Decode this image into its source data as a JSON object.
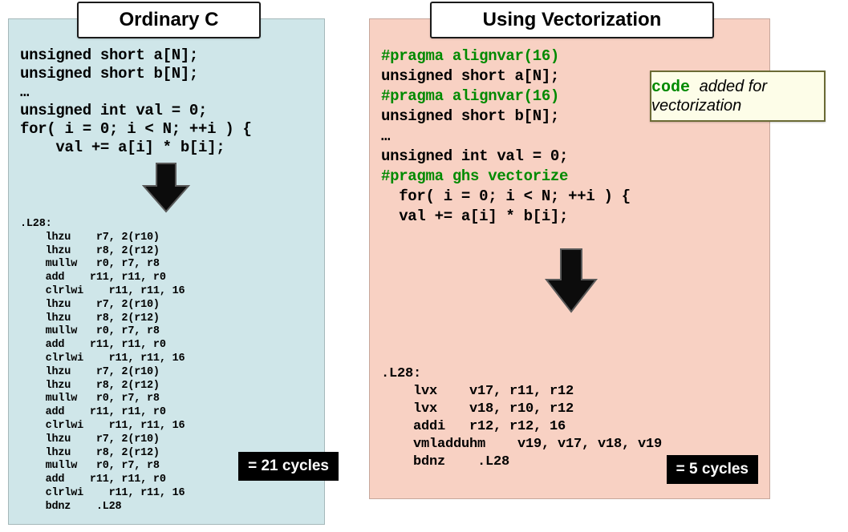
{
  "left": {
    "title": "Ordinary C",
    "ccode": "unsigned short a[N];\nunsigned short b[N];\n…\nunsigned int val = 0;\nfor( i = 0; i < N; ++i ) {\n    val += a[i] * b[i];",
    "asm": ".L28:\n    lhzu    r7, 2(r10)\n    lhzu    r8, 2(r12)\n    mullw   r0, r7, r8\n    add    r11, r11, r0\n    clrlwi    r11, r11, 16\n    lhzu    r7, 2(r10)\n    lhzu    r8, 2(r12)\n    mullw   r0, r7, r8\n    add    r11, r11, r0\n    clrlwi    r11, r11, 16\n    lhzu    r7, 2(r10)\n    lhzu    r8, 2(r12)\n    mullw   r0, r7, r8\n    add    r11, r11, r0\n    clrlwi    r11, r11, 16\n    lhzu    r7, 2(r10)\n    lhzu    r8, 2(r12)\n    mullw   r0, r7, r8\n    add    r11, r11, r0\n    clrlwi    r11, r11, 16\n    bdnz    .L28",
    "cycles": "= 21 cycles"
  },
  "right": {
    "title": "Using Vectorization",
    "lines": [
      {
        "t": "#pragma alignvar(16)",
        "g": true
      },
      {
        "t": "unsigned short a[N];",
        "g": false
      },
      {
        "t": "#pragma alignvar(16)",
        "g": true
      },
      {
        "t": "unsigned short b[N];",
        "g": false
      },
      {
        "t": "…",
        "g": false
      },
      {
        "t": "unsigned int val = 0;",
        "g": false
      },
      {
        "t": "#pragma ghs vectorize",
        "g": true
      },
      {
        "t": "  for( i = 0; i < N; ++i ) {",
        "g": false
      },
      {
        "t": "  val += a[i] * b[i];",
        "g": false
      }
    ],
    "asm": ".L28:\n    lvx    v17, r11, r12\n    lvx    v18, r10, r12\n    addi   r12, r12, 16\n    vmladduhm    v19, v17, v18, v19\n    bdnz    .L28",
    "cycles": "= 5 cycles"
  },
  "annotation": {
    "code_word": "code",
    "rest": " added for vectorization"
  }
}
